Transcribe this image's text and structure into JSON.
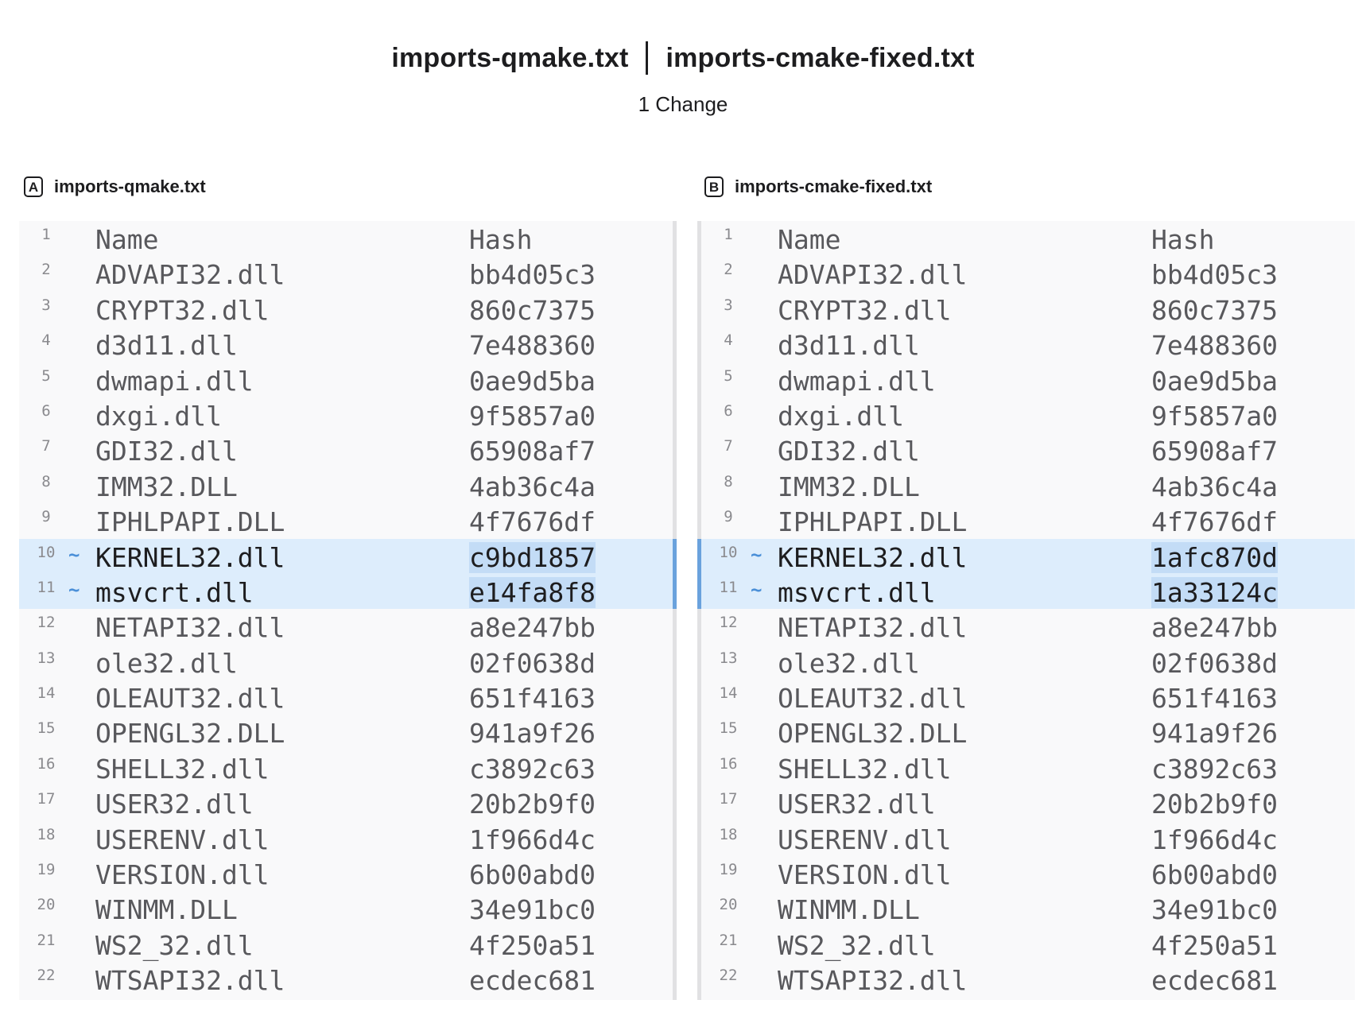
{
  "header": {
    "left_file": "imports-qmake.txt",
    "right_file": "imports-cmake-fixed.txt",
    "change_count": "1 Change"
  },
  "panes": [
    {
      "badge": "A",
      "filename": "imports-qmake.txt",
      "rows": [
        {
          "line": "1",
          "marker": "",
          "name": "Name",
          "hash": "Hash",
          "changed": false
        },
        {
          "line": "2",
          "marker": "",
          "name": "ADVAPI32.dll",
          "hash": "bb4d05c3",
          "changed": false
        },
        {
          "line": "3",
          "marker": "",
          "name": "CRYPT32.dll",
          "hash": "860c7375",
          "changed": false
        },
        {
          "line": "4",
          "marker": "",
          "name": "d3d11.dll",
          "hash": "7e488360",
          "changed": false
        },
        {
          "line": "5",
          "marker": "",
          "name": "dwmapi.dll",
          "hash": "0ae9d5ba",
          "changed": false
        },
        {
          "line": "6",
          "marker": "",
          "name": "dxgi.dll",
          "hash": "9f5857a0",
          "changed": false
        },
        {
          "line": "7",
          "marker": "",
          "name": "GDI32.dll",
          "hash": "65908af7",
          "changed": false
        },
        {
          "line": "8",
          "marker": "",
          "name": "IMM32.DLL",
          "hash": "4ab36c4a",
          "changed": false
        },
        {
          "line": "9",
          "marker": "",
          "name": "IPHLPAPI.DLL",
          "hash": "4f7676df",
          "changed": false
        },
        {
          "line": "10",
          "marker": "~",
          "name": "KERNEL32.dll",
          "hash": "c9bd1857",
          "changed": true
        },
        {
          "line": "11",
          "marker": "~",
          "name": "msvcrt.dll",
          "hash": "e14fa8f8",
          "changed": true
        },
        {
          "line": "12",
          "marker": "",
          "name": "NETAPI32.dll",
          "hash": "a8e247bb",
          "changed": false
        },
        {
          "line": "13",
          "marker": "",
          "name": "ole32.dll",
          "hash": "02f0638d",
          "changed": false
        },
        {
          "line": "14",
          "marker": "",
          "name": "OLEAUT32.dll",
          "hash": "651f4163",
          "changed": false
        },
        {
          "line": "15",
          "marker": "",
          "name": "OPENGL32.DLL",
          "hash": "941a9f26",
          "changed": false
        },
        {
          "line": "16",
          "marker": "",
          "name": "SHELL32.dll",
          "hash": "c3892c63",
          "changed": false
        },
        {
          "line": "17",
          "marker": "",
          "name": "USER32.dll",
          "hash": "20b2b9f0",
          "changed": false
        },
        {
          "line": "18",
          "marker": "",
          "name": "USERENV.dll",
          "hash": "1f966d4c",
          "changed": false
        },
        {
          "line": "19",
          "marker": "",
          "name": "VERSION.dll",
          "hash": "6b00abd0",
          "changed": false
        },
        {
          "line": "20",
          "marker": "",
          "name": "WINMM.DLL",
          "hash": "34e91bc0",
          "changed": false
        },
        {
          "line": "21",
          "marker": "",
          "name": "WS2_32.dll",
          "hash": "4f250a51",
          "changed": false
        },
        {
          "line": "22",
          "marker": "",
          "name": "WTSAPI32.dll",
          "hash": "ecdec681",
          "changed": false
        }
      ]
    },
    {
      "badge": "B",
      "filename": "imports-cmake-fixed.txt",
      "rows": [
        {
          "line": "1",
          "marker": "",
          "name": "Name",
          "hash": "Hash",
          "changed": false
        },
        {
          "line": "2",
          "marker": "",
          "name": "ADVAPI32.dll",
          "hash": "bb4d05c3",
          "changed": false
        },
        {
          "line": "3",
          "marker": "",
          "name": "CRYPT32.dll",
          "hash": "860c7375",
          "changed": false
        },
        {
          "line": "4",
          "marker": "",
          "name": "d3d11.dll",
          "hash": "7e488360",
          "changed": false
        },
        {
          "line": "5",
          "marker": "",
          "name": "dwmapi.dll",
          "hash": "0ae9d5ba",
          "changed": false
        },
        {
          "line": "6",
          "marker": "",
          "name": "dxgi.dll",
          "hash": "9f5857a0",
          "changed": false
        },
        {
          "line": "7",
          "marker": "",
          "name": "GDI32.dll",
          "hash": "65908af7",
          "changed": false
        },
        {
          "line": "8",
          "marker": "",
          "name": "IMM32.DLL",
          "hash": "4ab36c4a",
          "changed": false
        },
        {
          "line": "9",
          "marker": "",
          "name": "IPHLPAPI.DLL",
          "hash": "4f7676df",
          "changed": false
        },
        {
          "line": "10",
          "marker": "~",
          "name": "KERNEL32.dll",
          "hash": "1afc870d",
          "changed": true
        },
        {
          "line": "11",
          "marker": "~",
          "name": "msvcrt.dll",
          "hash": "1a33124c",
          "changed": true
        },
        {
          "line": "12",
          "marker": "",
          "name": "NETAPI32.dll",
          "hash": "a8e247bb",
          "changed": false
        },
        {
          "line": "13",
          "marker": "",
          "name": "ole32.dll",
          "hash": "02f0638d",
          "changed": false
        },
        {
          "line": "14",
          "marker": "",
          "name": "OLEAUT32.dll",
          "hash": "651f4163",
          "changed": false
        },
        {
          "line": "15",
          "marker": "",
          "name": "OPENGL32.DLL",
          "hash": "941a9f26",
          "changed": false
        },
        {
          "line": "16",
          "marker": "",
          "name": "SHELL32.dll",
          "hash": "c3892c63",
          "changed": false
        },
        {
          "line": "17",
          "marker": "",
          "name": "USER32.dll",
          "hash": "20b2b9f0",
          "changed": false
        },
        {
          "line": "18",
          "marker": "",
          "name": "USERENV.dll",
          "hash": "1f966d4c",
          "changed": false
        },
        {
          "line": "19",
          "marker": "",
          "name": "VERSION.dll",
          "hash": "6b00abd0",
          "changed": false
        },
        {
          "line": "20",
          "marker": "",
          "name": "WINMM.DLL",
          "hash": "34e91bc0",
          "changed": false
        },
        {
          "line": "21",
          "marker": "",
          "name": "WS2_32.dll",
          "hash": "4f250a51",
          "changed": false
        },
        {
          "line": "22",
          "marker": "",
          "name": "WTSAPI32.dll",
          "hash": "ecdec681",
          "changed": false
        }
      ]
    }
  ],
  "colors": {
    "changed_row_bg": "#ddedfc",
    "changed_hash_bg": "#c3dcf6",
    "change_marker": "#4a8fd8",
    "change_bar": "#6aa2dd"
  }
}
